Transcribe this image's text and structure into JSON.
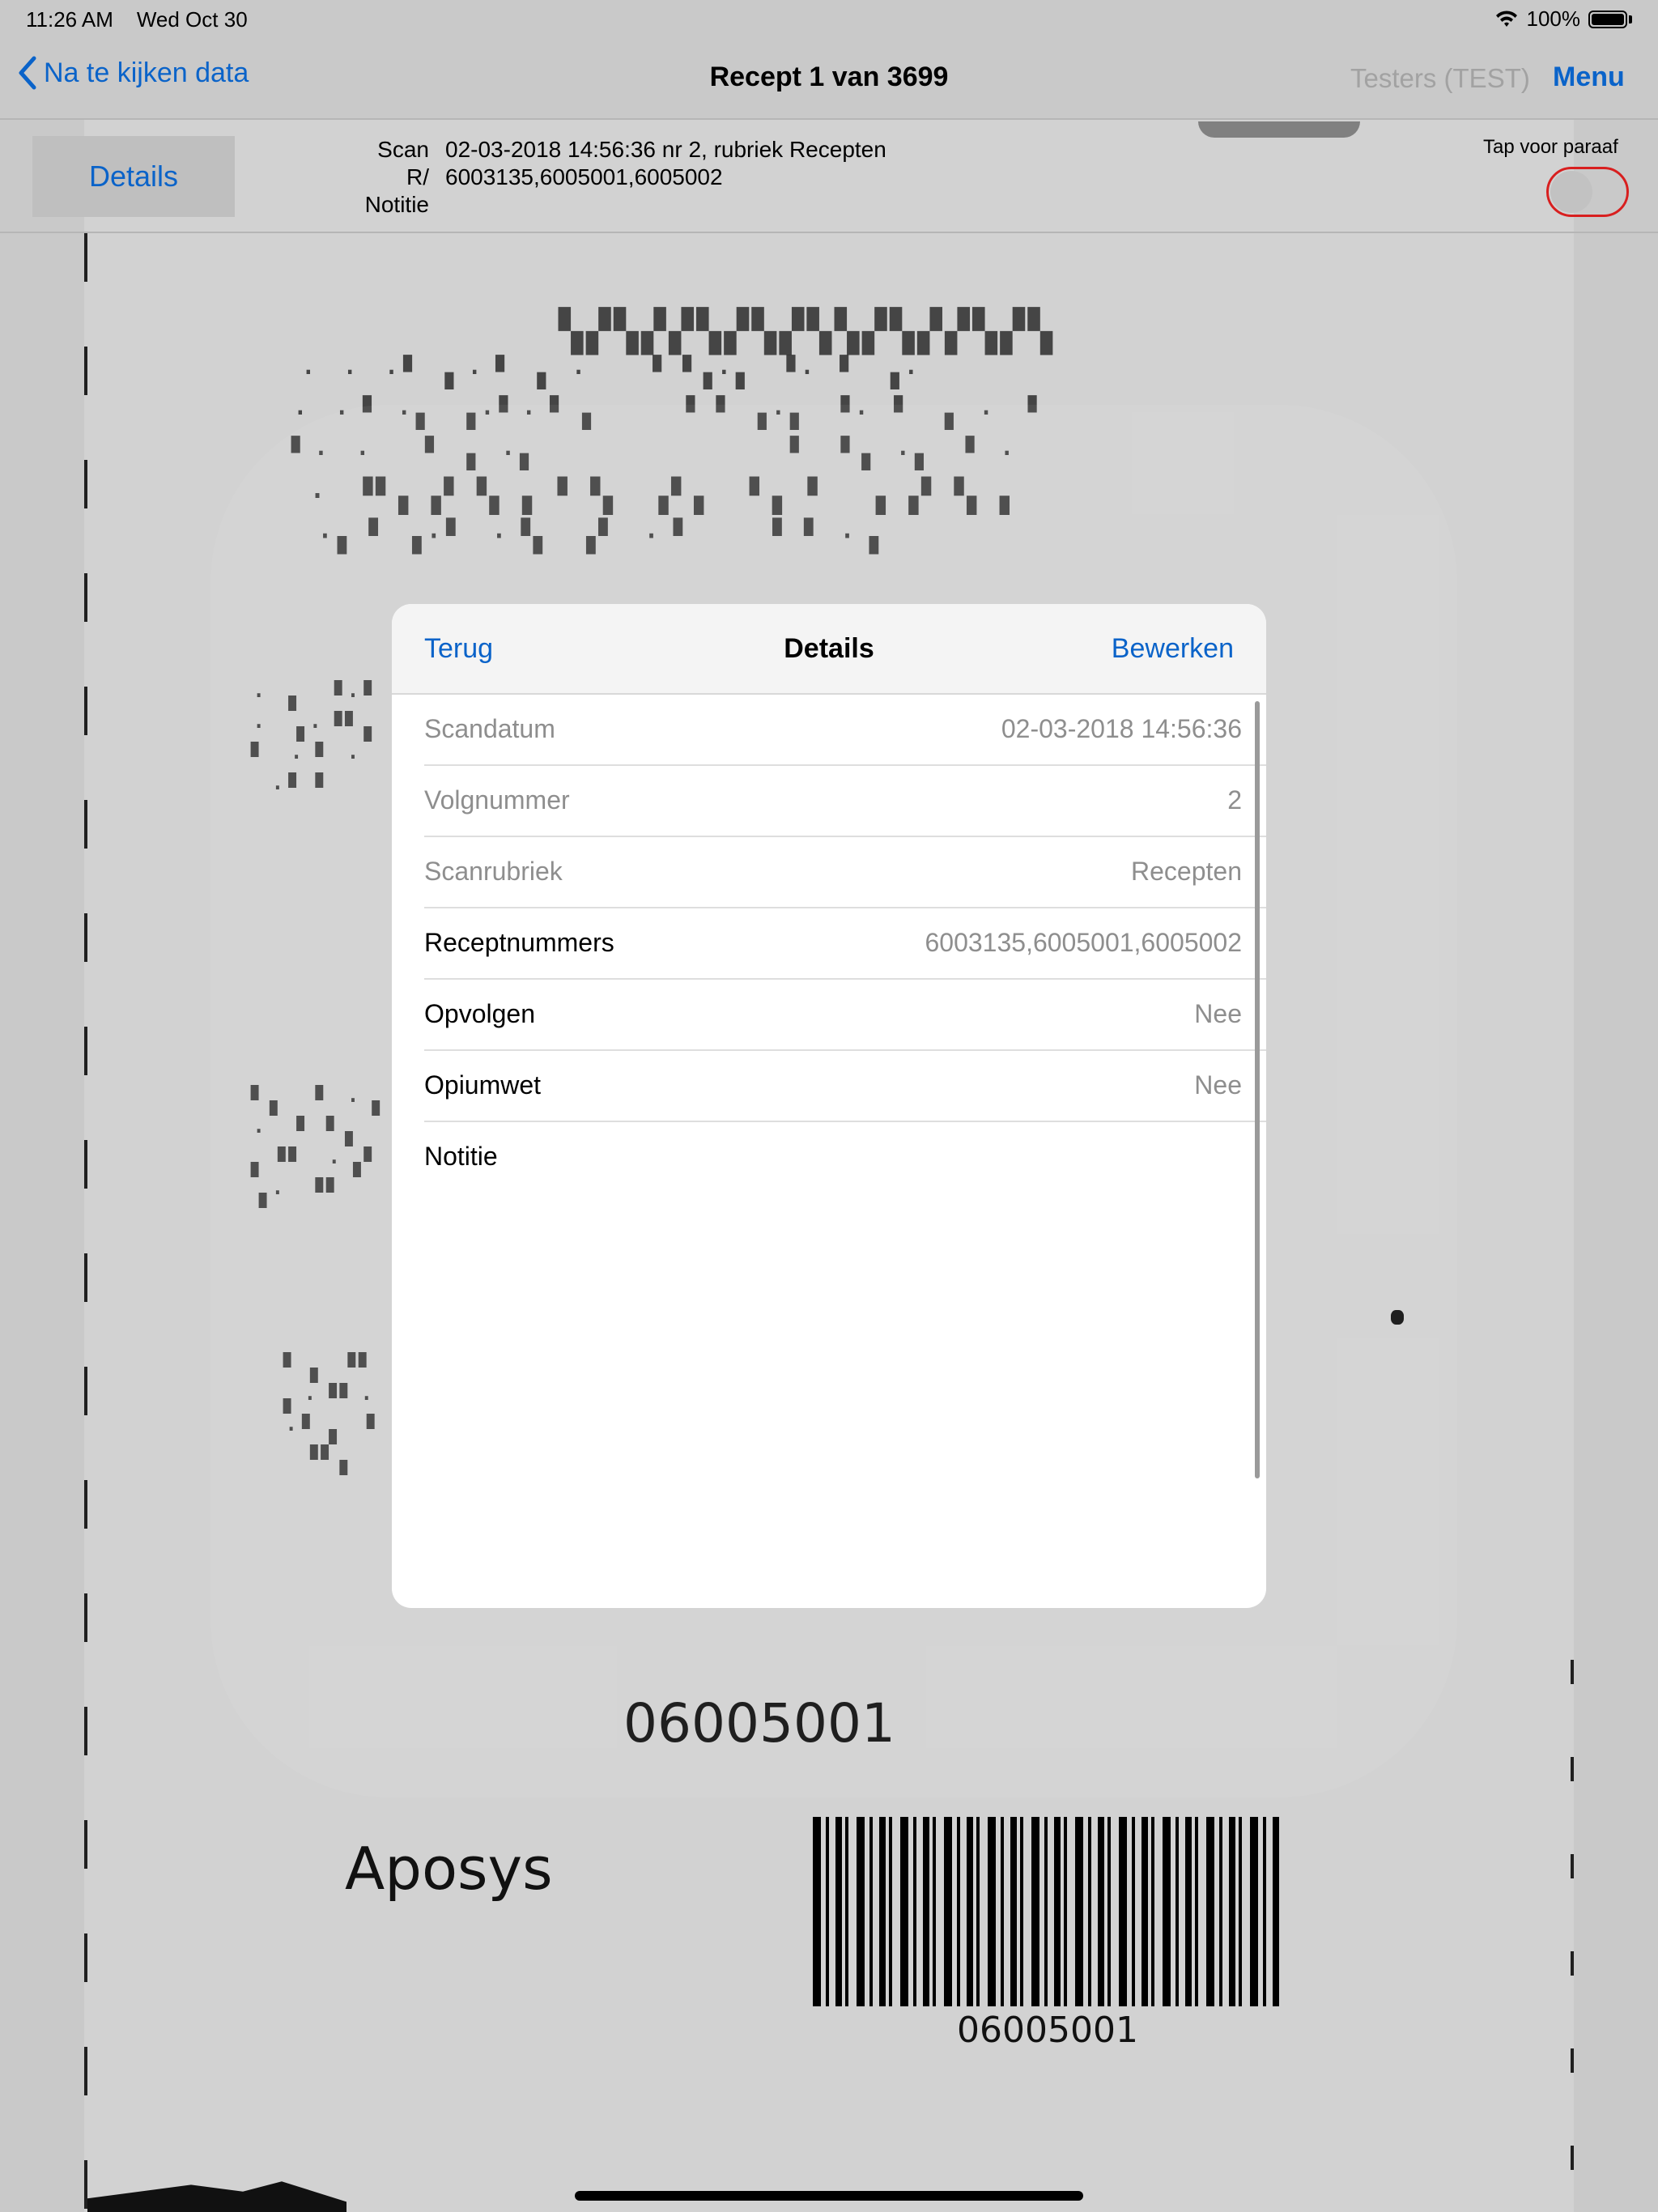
{
  "status_bar": {
    "time": "11:26 AM",
    "date": "Wed Oct 30",
    "battery": "100%"
  },
  "nav": {
    "back_label": "Na te kijken data",
    "title": "Recept 1 van 3699",
    "user": "Testers (TEST)",
    "menu_label": "Menu"
  },
  "info": {
    "details_tab": "Details",
    "labels": {
      "scan": "Scan",
      "r": "R/",
      "notitie": "Notitie"
    },
    "values": {
      "scan": "02-03-2018 14:56:36 nr 2, rubriek Recepten",
      "r": "6003135,6005001,6005002"
    },
    "paraaf_label": "Tap voor paraaf"
  },
  "scan_image": {
    "number": "06005001",
    "brand": "Aposys",
    "barcode_number": "06005001"
  },
  "modal": {
    "back_label": "Terug",
    "title": "Details",
    "edit_label": "Bewerken",
    "rows": [
      {
        "label": "Scandatum",
        "value": "02-03-2018 14:56:36"
      },
      {
        "label": "Volgnummer",
        "value": "2"
      },
      {
        "label": "Scanrubriek",
        "value": "Recepten"
      },
      {
        "label": "Receptnummers",
        "value": "6003135,6005001,6005002"
      },
      {
        "label": "Opvolgen",
        "value": "Nee"
      },
      {
        "label": "Opiumwet",
        "value": "Nee"
      },
      {
        "label": "Notitie",
        "value": ""
      }
    ]
  },
  "colors": {
    "accent": "#0a63c9",
    "toggle_border": "#d81f1f",
    "muted_text": "#8e8e8e"
  }
}
